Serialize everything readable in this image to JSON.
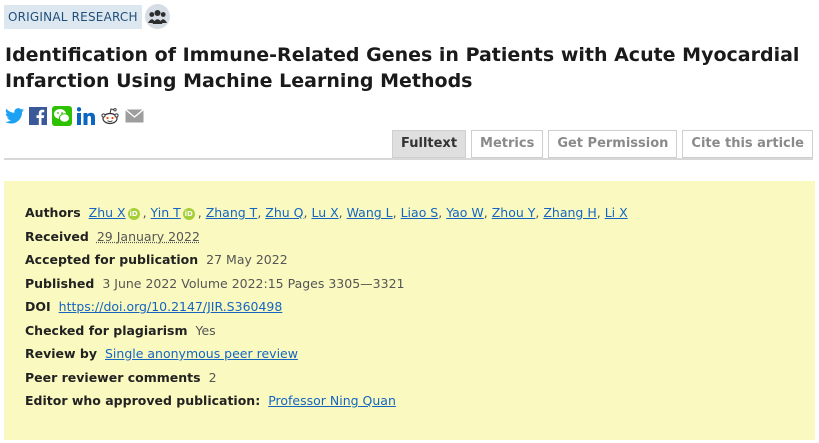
{
  "header": {
    "tag": "ORIGINAL RESEARCH",
    "icon": "group-icon",
    "title": "Identification of Immune-Related Genes in Patients with Acute Myocardial Infarction Using Machine Learning Methods"
  },
  "share_icons": [
    "twitter-icon",
    "facebook-icon",
    "wechat-icon",
    "linkedin-icon",
    "reddit-icon",
    "email-icon"
  ],
  "tabs": [
    {
      "label": "Fulltext",
      "active": true
    },
    {
      "label": "Metrics",
      "active": false
    },
    {
      "label": "Get Permission",
      "active": false
    },
    {
      "label": "Cite this article",
      "active": false
    }
  ],
  "meta": {
    "authors_label": "Authors",
    "authors": [
      "Zhu X",
      "Yin T",
      "Zhang T",
      "Zhu Q",
      "Lu X",
      "Wang L",
      "Liao S",
      "Yao W",
      "Zhou Y",
      "Zhang H",
      "Li X"
    ],
    "received_label": "Received",
    "received": "29 January 2022",
    "accepted_label": "Accepted for publication",
    "accepted": "27 May 2022",
    "published_label": "Published",
    "published": "3 June 2022 Volume 2022:15 Pages 3305—3321",
    "doi_label": "DOI",
    "doi": "https://doi.org/10.2147/JIR.S360498",
    "plagiarism_label": "Checked for plagiarism",
    "plagiarism": "Yes",
    "review_label": "Review by",
    "review": "Single anonymous peer review",
    "comments_label": "Peer reviewer comments",
    "comments": "2",
    "editor_label": "Editor who approved publication:",
    "editor": "Professor Ning Quan"
  },
  "colors": {
    "panel": "#fafac0",
    "link": "#1565c0",
    "tag_bg": "#dde7f0",
    "orcid": "#a6ce39"
  }
}
